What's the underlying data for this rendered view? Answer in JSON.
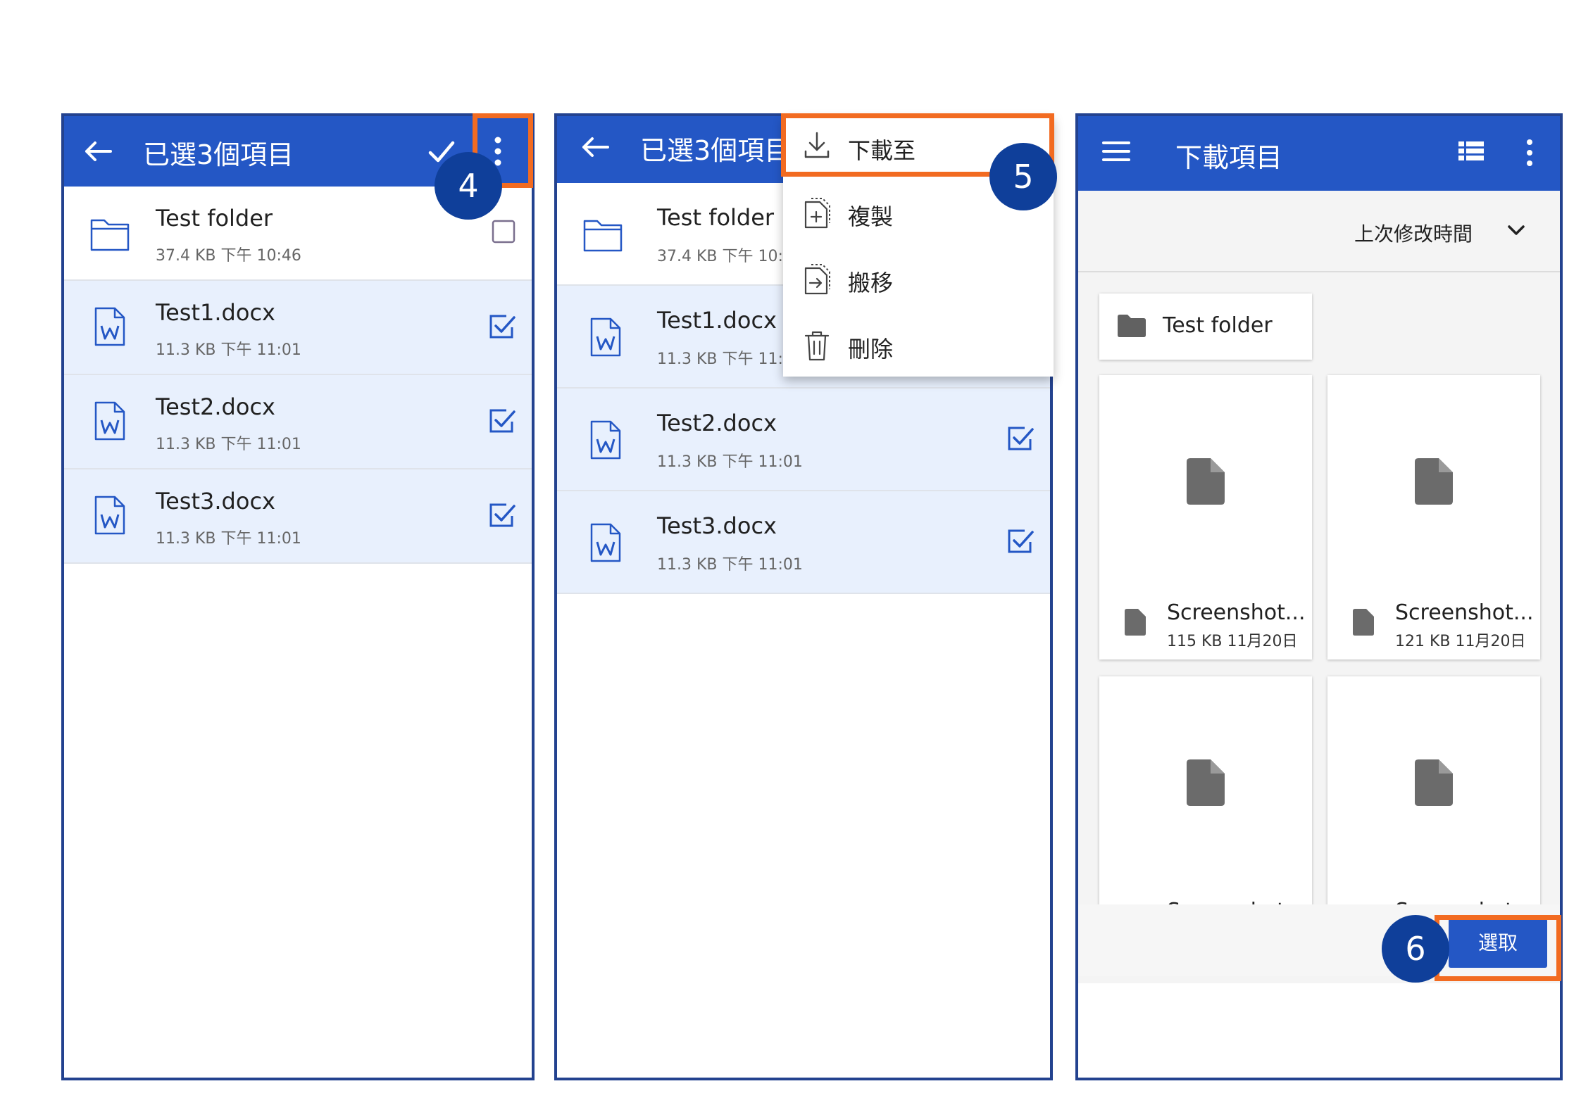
{
  "colors": {
    "appbar": "#2457c5",
    "panel_border": "#23428f",
    "highlight": "#f26b21",
    "badge": "#0f3f9a",
    "selected_row": "#e8f0fd",
    "check": "#2457c5"
  },
  "panel1": {
    "title": "已選3個項目",
    "back_icon": "arrow-left-icon",
    "check_icon": "checkmark-icon",
    "more_icon": "more-vert-icon",
    "step_badge": "4",
    "items": [
      {
        "name": "Test folder",
        "meta": "37.4 KB  下午 10:46",
        "icon": "folder-icon",
        "checked": false
      },
      {
        "name": "Test1.docx",
        "meta": "11.3 KB  下午 11:01",
        "icon": "word-doc-icon",
        "checked": true
      },
      {
        "name": "Test2.docx",
        "meta": "11.3 KB  下午 11:01",
        "icon": "word-doc-icon",
        "checked": true
      },
      {
        "name": "Test3.docx",
        "meta": "11.3 KB  下午 11:01",
        "icon": "word-doc-icon",
        "checked": true
      }
    ]
  },
  "panel2": {
    "title": "已選3個項目",
    "step_badge": "5",
    "items": [
      {
        "name": "Test folder",
        "meta": "37.4 KB  下午 10:",
        "icon": "folder-icon"
      },
      {
        "name": "Test1.docx",
        "meta": "11.3 KB  下午 11:",
        "icon": "word-doc-icon"
      },
      {
        "name": "Test2.docx",
        "meta": "11.3 KB  下午 11:01",
        "icon": "word-doc-icon",
        "checked": true
      },
      {
        "name": "Test3.docx",
        "meta": "11.3 KB  下午 11:01",
        "icon": "word-doc-icon",
        "checked": true
      }
    ],
    "menu": [
      {
        "label": "下載至",
        "icon": "download-icon"
      },
      {
        "label": "複製",
        "icon": "copy-file-icon"
      },
      {
        "label": "搬移",
        "icon": "move-file-icon"
      },
      {
        "label": "刪除",
        "icon": "trash-icon"
      }
    ]
  },
  "panel3": {
    "title": "下載項目",
    "menu_icon": "hamburger-menu-icon",
    "list_view_icon": "list-view-icon",
    "more_icon": "more-vert-icon",
    "sort_label": "上次修改時間",
    "sort_icon": "chevron-down-icon",
    "folder_name": "Test folder",
    "files": [
      {
        "name": "Screenshot...",
        "meta": "115 KB 11月20日"
      },
      {
        "name": "Screenshot...",
        "meta": "121 KB 11月20日"
      },
      {
        "name": "Screenshot",
        "meta": ""
      },
      {
        "name": "Screenshot",
        "meta": ""
      }
    ],
    "select_button": "選取",
    "step_badge": "6"
  }
}
